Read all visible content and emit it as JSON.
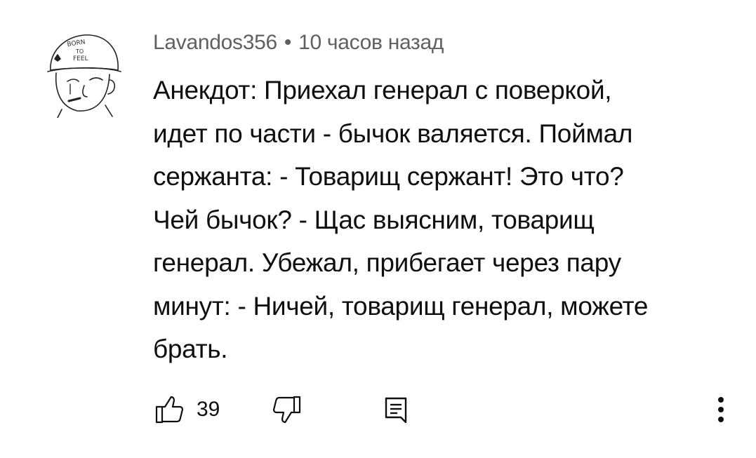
{
  "comment": {
    "author": "Lavandos356",
    "separator": "•",
    "time": "10 часов назад",
    "lines": [
      "Анекдот: Приехал генерал с поверкой,",
      "идет по части - бычок валяется. Поймал",
      "сержанта: - Товарищ сержант! Это что?",
      "Чей бычок? - Щас выясним, товарищ",
      "генерал. Убежал, прибегает через пару",
      "минут: - Ничей, товарищ генерал, можете",
      "брать."
    ],
    "avatar": {
      "icon": "soldier-avatar-icon",
      "helmet_text": [
        "BORN",
        "TO",
        "FEEL"
      ]
    }
  },
  "actions": {
    "like_icon": "thumbs-up-icon",
    "like_count": "39",
    "dislike_icon": "thumbs-down-icon",
    "reply_icon": "reply-comment-icon",
    "more_icon": "more-vertical-icon"
  },
  "colors": {
    "text": "#0f0f0f",
    "meta": "#606060",
    "background": "#ffffff"
  }
}
